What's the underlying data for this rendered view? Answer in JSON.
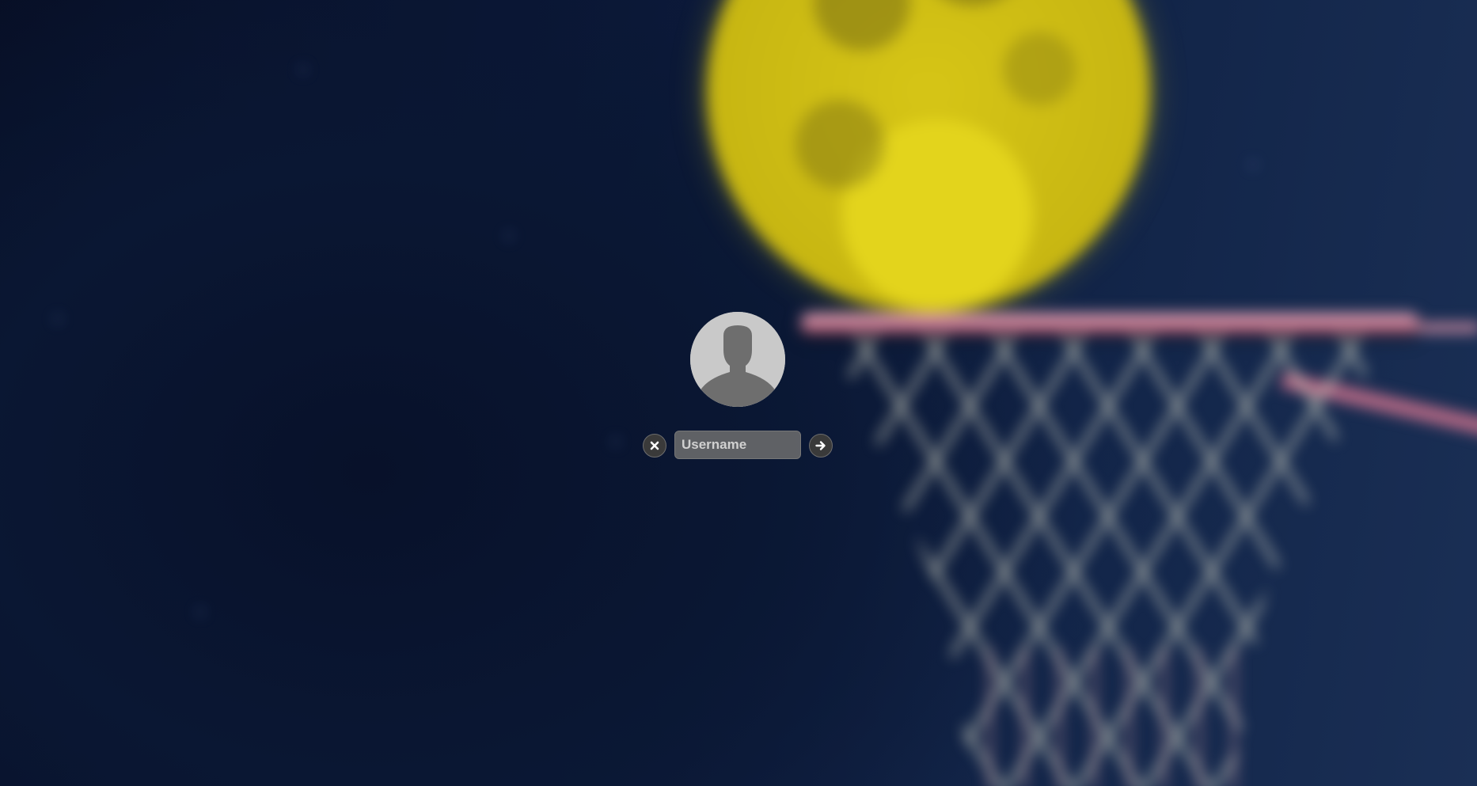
{
  "login": {
    "username_placeholder": "Username",
    "username_value": ""
  },
  "icons": {
    "avatar": "default-user-silhouette",
    "cancel": "close-icon",
    "submit": "arrow-right-icon"
  },
  "colors": {
    "background": "#0b1630",
    "moon": "#d6c516",
    "rim": "#c67a92",
    "button": "#3a3a3a",
    "input": "#6e6e6e"
  }
}
